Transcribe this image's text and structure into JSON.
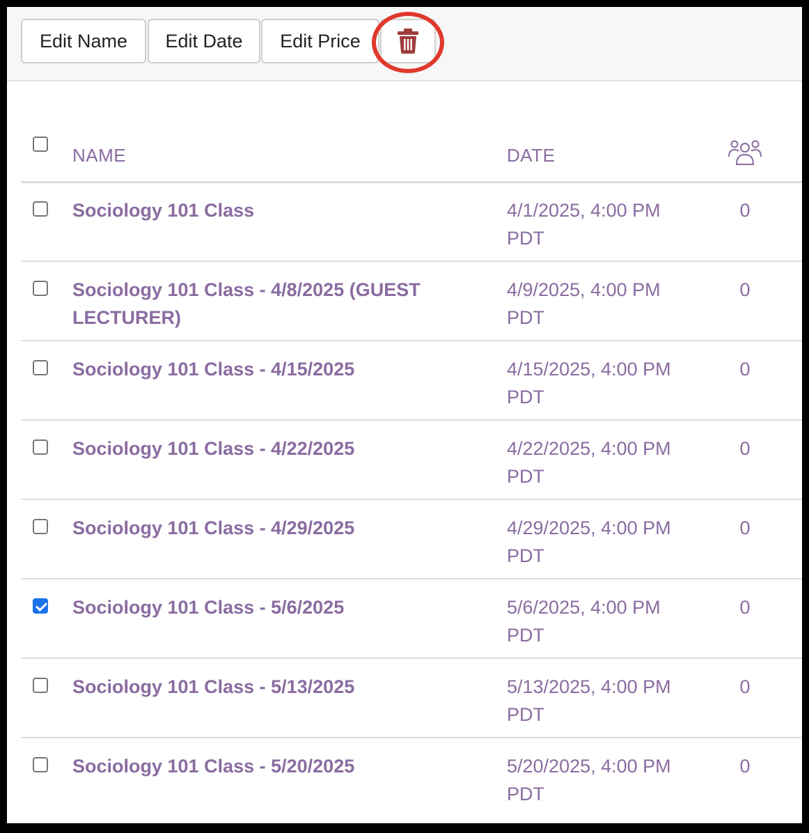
{
  "toolbar": {
    "edit_name_label": "Edit Name",
    "edit_date_label": "Edit Date",
    "edit_price_label": "Edit Price",
    "delete_icon": "trash-icon",
    "delete_color": "#a23b3b",
    "highlight_color": "#e0392c"
  },
  "table": {
    "headers": {
      "name": "NAME",
      "date": "DATE",
      "attendees_icon": "people-icon"
    },
    "select_all_checked": false,
    "rows": [
      {
        "name": "Sociology 101 Class",
        "date": "4/1/2025, 4:00 PM PDT",
        "count": "0",
        "checked": false
      },
      {
        "name": "Sociology 101 Class - 4/8/2025 (GUEST LECTURER)",
        "date": "4/9/2025, 4:00 PM PDT",
        "count": "0",
        "checked": false
      },
      {
        "name": "Sociology 101 Class - 4/15/2025",
        "date": "4/15/2025, 4:00 PM PDT",
        "count": "0",
        "checked": false
      },
      {
        "name": "Sociology 101 Class - 4/22/2025",
        "date": "4/22/2025, 4:00 PM PDT",
        "count": "0",
        "checked": false
      },
      {
        "name": "Sociology 101 Class - 4/29/2025",
        "date": "4/29/2025, 4:00 PM PDT",
        "count": "0",
        "checked": false
      },
      {
        "name": "Sociology 101 Class - 5/6/2025",
        "date": "5/6/2025, 4:00 PM PDT",
        "count": "0",
        "checked": true
      },
      {
        "name": "Sociology 101 Class - 5/13/2025",
        "date": "5/13/2025, 4:00 PM PDT",
        "count": "0",
        "checked": false
      },
      {
        "name": "Sociology 101 Class - 5/20/2025",
        "date": "5/20/2025, 4:00 PM PDT",
        "count": "0",
        "checked": false
      }
    ]
  },
  "colors": {
    "accent_text": "#8a6ca0",
    "checkbox_checked": "#1a73e8"
  }
}
